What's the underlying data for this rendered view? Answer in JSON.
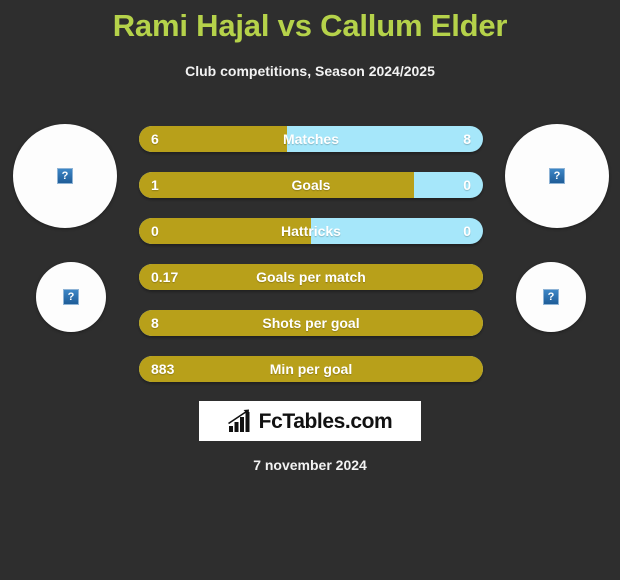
{
  "header": {
    "title": "Rami Hajal vs Callum Elder",
    "subtitle": "Club competitions, Season 2024/2025",
    "title_color": "#b5d24a"
  },
  "colors": {
    "background": "#2e2e2e",
    "home_bar": "#b8a01a",
    "away_bar": "#a6e7fa",
    "title": "#b5d24a",
    "text": "#ffffff"
  },
  "avatars": [
    {
      "name": "home-player-photo-top",
      "placeholder": "?"
    },
    {
      "name": "away-player-photo-top",
      "placeholder": "?"
    },
    {
      "name": "home-player-photo-bottom",
      "placeholder": "?"
    },
    {
      "name": "away-player-photo-bottom",
      "placeholder": "?"
    }
  ],
  "stats": [
    {
      "label": "Matches",
      "home": "6",
      "away": "8",
      "home_pct": 43
    },
    {
      "label": "Goals",
      "home": "1",
      "away": "0",
      "home_pct": 80
    },
    {
      "label": "Hattricks",
      "home": "0",
      "away": "0",
      "home_pct": 50
    },
    {
      "label": "Goals per match",
      "home": "0.17",
      "away": "",
      "home_pct": 100
    },
    {
      "label": "Shots per goal",
      "home": "8",
      "away": "",
      "home_pct": 100
    },
    {
      "label": "Min per goal",
      "home": "883",
      "away": "",
      "home_pct": 100
    }
  ],
  "footer": {
    "logo_text": "FcTables.com",
    "logo_icon": "bar-chart-growth-icon",
    "date": "7 november 2024"
  }
}
